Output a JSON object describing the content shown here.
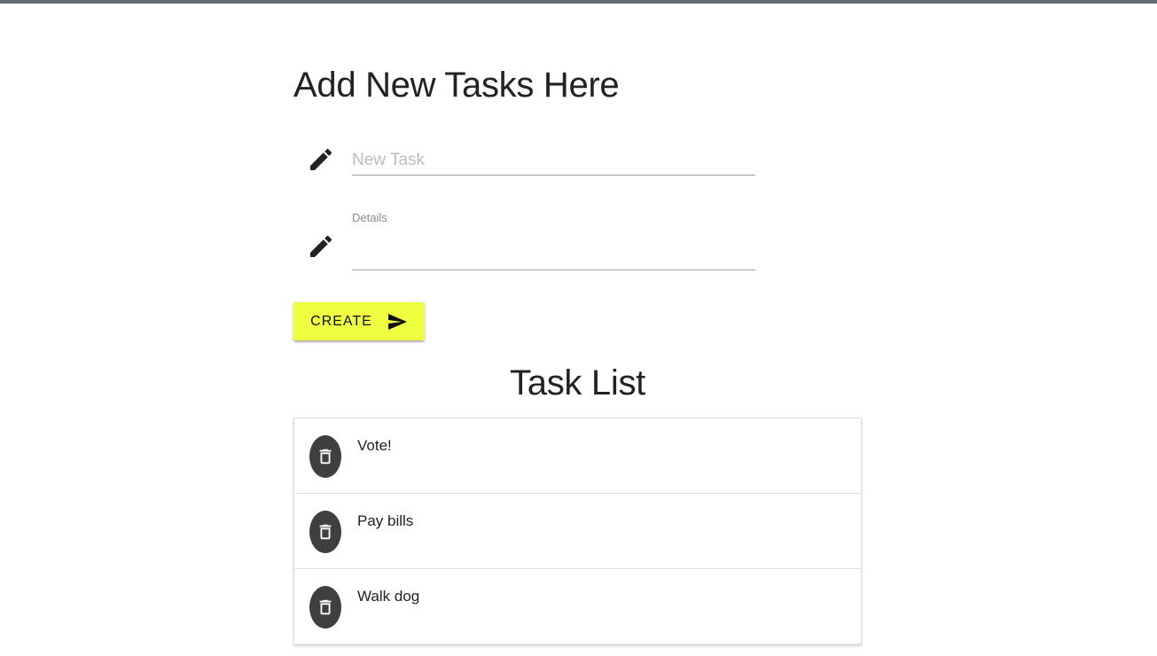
{
  "form": {
    "title": "Add New Tasks Here",
    "task_field": {
      "placeholder": "New Task",
      "value": "",
      "icon": "pencil-icon"
    },
    "details_field": {
      "label": "Details",
      "value": "",
      "icon": "pencil-icon"
    },
    "create_button": {
      "label": "CREATE",
      "icon": "send-icon",
      "color": "#eeff41"
    }
  },
  "task_list": {
    "title": "Task List",
    "delete_icon": "trash-icon",
    "items": [
      {
        "title": "Vote!"
      },
      {
        "title": "Pay bills"
      },
      {
        "title": "Walk dog"
      }
    ]
  },
  "colors": {
    "top_bar": "#5f6d73",
    "delete_button": "#3f3f3f"
  }
}
